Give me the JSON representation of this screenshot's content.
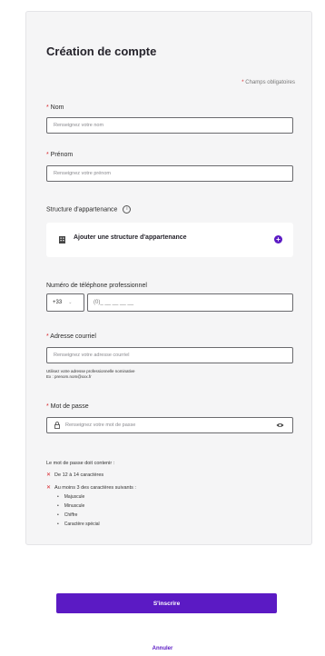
{
  "form": {
    "title": "Création de compte",
    "required_note_star": "*",
    "required_note": "Champs obligatoires",
    "nom": {
      "label": "Nom",
      "placeholder": "Renseignez votre nom"
    },
    "prenom": {
      "label": "Prénom",
      "placeholder": "Renseignez votre prénom"
    },
    "structure": {
      "label": "Structure d'appartenance",
      "info_icon": "info-icon",
      "add_text": "Ajouter une structure d'appartenance",
      "add_button": "+"
    },
    "phone": {
      "label": "Numéro de téléphone professionnel",
      "prefix": "+33",
      "placeholder": "(0)_ __ __ __ __"
    },
    "email": {
      "label": "Adresse courriel",
      "placeholder": "Renseignez votre adresse courriel",
      "hint_line1": "Utilisez votre adresse professionnelle nominative",
      "hint_line2": "Ex : prenom.nom@xxx.fr"
    },
    "password": {
      "label": "Mot de passe",
      "placeholder": "Renseignez votre mot de passe"
    },
    "rules": {
      "title": "Le mot de passe doit contenir :",
      "items": [
        "De 12 à 14 caractères",
        "Au moins 3 des caractères suivants :"
      ],
      "subitems": [
        "Majuscule",
        "Minuscule",
        "Chiffre",
        "Caractère spécial"
      ]
    }
  },
  "actions": {
    "submit": "S'inscrire",
    "cancel": "Annuler"
  },
  "colors": {
    "accent": "#5b1ac4",
    "required": "#d9262c"
  }
}
